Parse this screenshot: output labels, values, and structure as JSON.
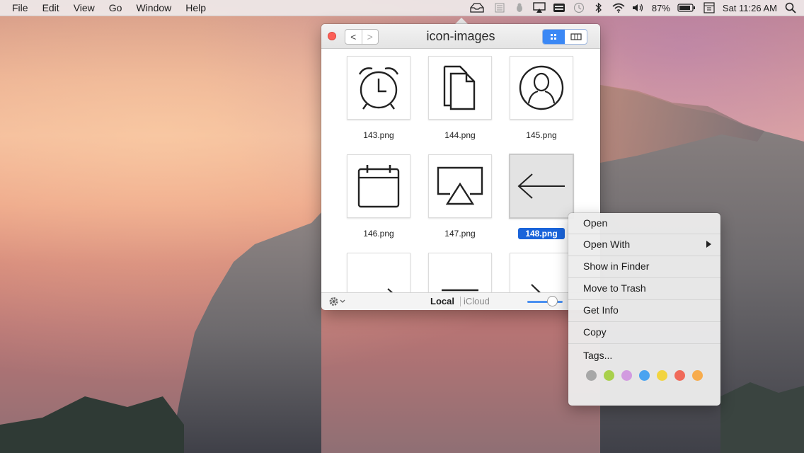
{
  "menubar": {
    "menus": [
      "File",
      "Edit",
      "View",
      "Go",
      "Window",
      "Help"
    ],
    "status_icons": [
      "tray-icon",
      "notes-icon",
      "bug-icon",
      "airplay-icon",
      "keyboard-icon",
      "time-machine-icon",
      "bluetooth-icon",
      "wifi-icon",
      "volume-icon"
    ],
    "battery": "87%",
    "clock": "Sat 11:26 AM"
  },
  "window": {
    "title": "icon-images",
    "nav": {
      "back": "<",
      "forward": ">"
    },
    "view_mode": "grid"
  },
  "files": [
    {
      "name": "143.png",
      "icon": "alarm-clock-icon"
    },
    {
      "name": "144.png",
      "icon": "documents-icon"
    },
    {
      "name": "145.png",
      "icon": "user-icon"
    },
    {
      "name": "146.png",
      "icon": "calendar-icon"
    },
    {
      "name": "147.png",
      "icon": "airplay-icon"
    },
    {
      "name": "148.png",
      "icon": "arrow-left-icon",
      "selected": true
    },
    {
      "name": "",
      "icon": "arrow-right-icon"
    },
    {
      "name": "",
      "icon": "menu-lines-icon"
    },
    {
      "name": "",
      "icon": "chevron-right-icon"
    }
  ],
  "bottom_bar": {
    "local": "Local",
    "icloud": "iCloud",
    "zoom_level": 0.7
  },
  "context_menu": {
    "items": [
      "Open",
      "Open With",
      "Show in Finder",
      "Move to Trash",
      "Get Info",
      "Copy",
      "Tags..."
    ],
    "tags": [
      {
        "name": "gray",
        "color": "#a7a7a7"
      },
      {
        "name": "green",
        "color": "#a8d04b"
      },
      {
        "name": "purple",
        "color": "#d29be0"
      },
      {
        "name": "blue",
        "color": "#4aa3f0"
      },
      {
        "name": "yellow",
        "color": "#f2d43f"
      },
      {
        "name": "red",
        "color": "#f06a5a"
      },
      {
        "name": "orange",
        "color": "#f7ac4d"
      }
    ]
  }
}
